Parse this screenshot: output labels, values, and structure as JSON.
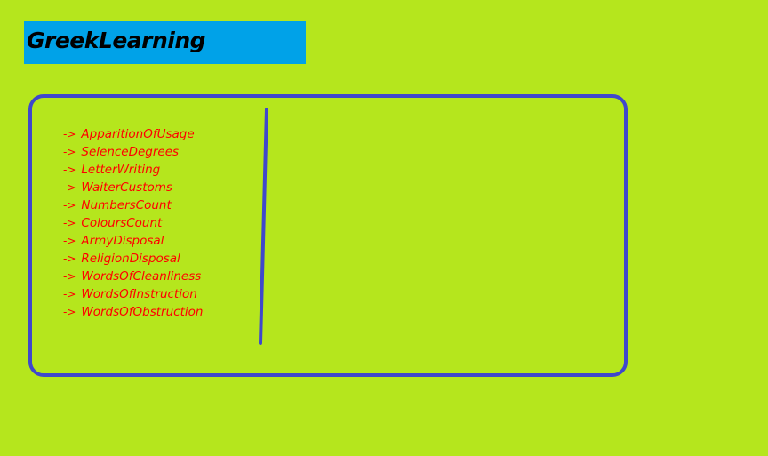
{
  "header": {
    "title": "GreekLearning"
  },
  "menu": {
    "arrow": "->",
    "items": [
      {
        "label": "ApparitionOfUsage"
      },
      {
        "label": "SelenceDegrees"
      },
      {
        "label": "LetterWriting"
      },
      {
        "label": "WaiterCustoms"
      },
      {
        "label": "NumbersCount"
      },
      {
        "label": "ColoursCount"
      },
      {
        "label": "ArmyDisposal"
      },
      {
        "label": "ReligionDisposal"
      },
      {
        "label": "WordsOfCleanliness"
      },
      {
        "label": "WordsOfInstruction"
      },
      {
        "label": "WordsOfObstruction"
      }
    ]
  },
  "colors": {
    "background": "#b5e61d",
    "header_background": "#00a2e8",
    "panel_border": "#3f48cc",
    "menu_text": "#ff0000",
    "title_text": "#000000"
  }
}
